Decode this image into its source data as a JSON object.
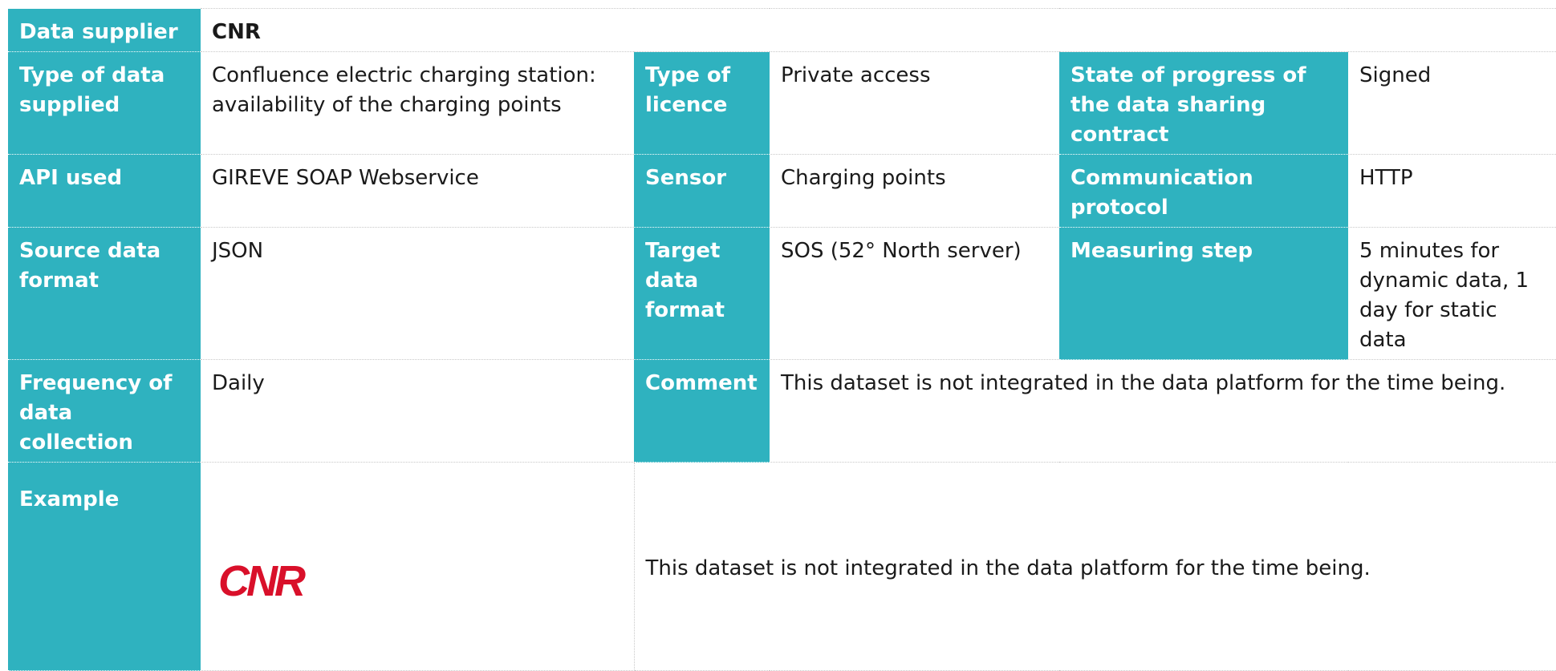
{
  "rows": {
    "r1": {
      "label": "Data supplier",
      "value": "CNR"
    },
    "r2": {
      "label": "Type of data supplied",
      "value": "Confluence electric charging station: availability of the charging points",
      "label2": "Type of licence",
      "value2": "Private access",
      "label3": "State of progress of the data sharing contract",
      "value3": "Signed"
    },
    "r3": {
      "label": "API used",
      "value": "GIREVE SOAP Webservice",
      "label2": "Sensor",
      "value2": "Charging points",
      "label3": "Communication protocol",
      "value3": "HTTP"
    },
    "r4": {
      "label": "Source data format",
      "value": "JSON",
      "label2": "Target data format",
      "value2": "SOS (52° North server)",
      "label3": "Measuring step",
      "value3": "5 minutes for dynamic data, 1 day for static data"
    },
    "r5": {
      "label": "Frequency of data collection",
      "value": "Daily",
      "label2": "Comment",
      "value2": "This dataset is not integrated in the data platform for the time being."
    },
    "r6": {
      "label": "Example",
      "logo_text": "CNR",
      "text": "This dataset is not integrated in the data platform for the time being."
    }
  },
  "colors": {
    "label_bg": "#2fb2bf",
    "logo_red": "#d9102a"
  }
}
